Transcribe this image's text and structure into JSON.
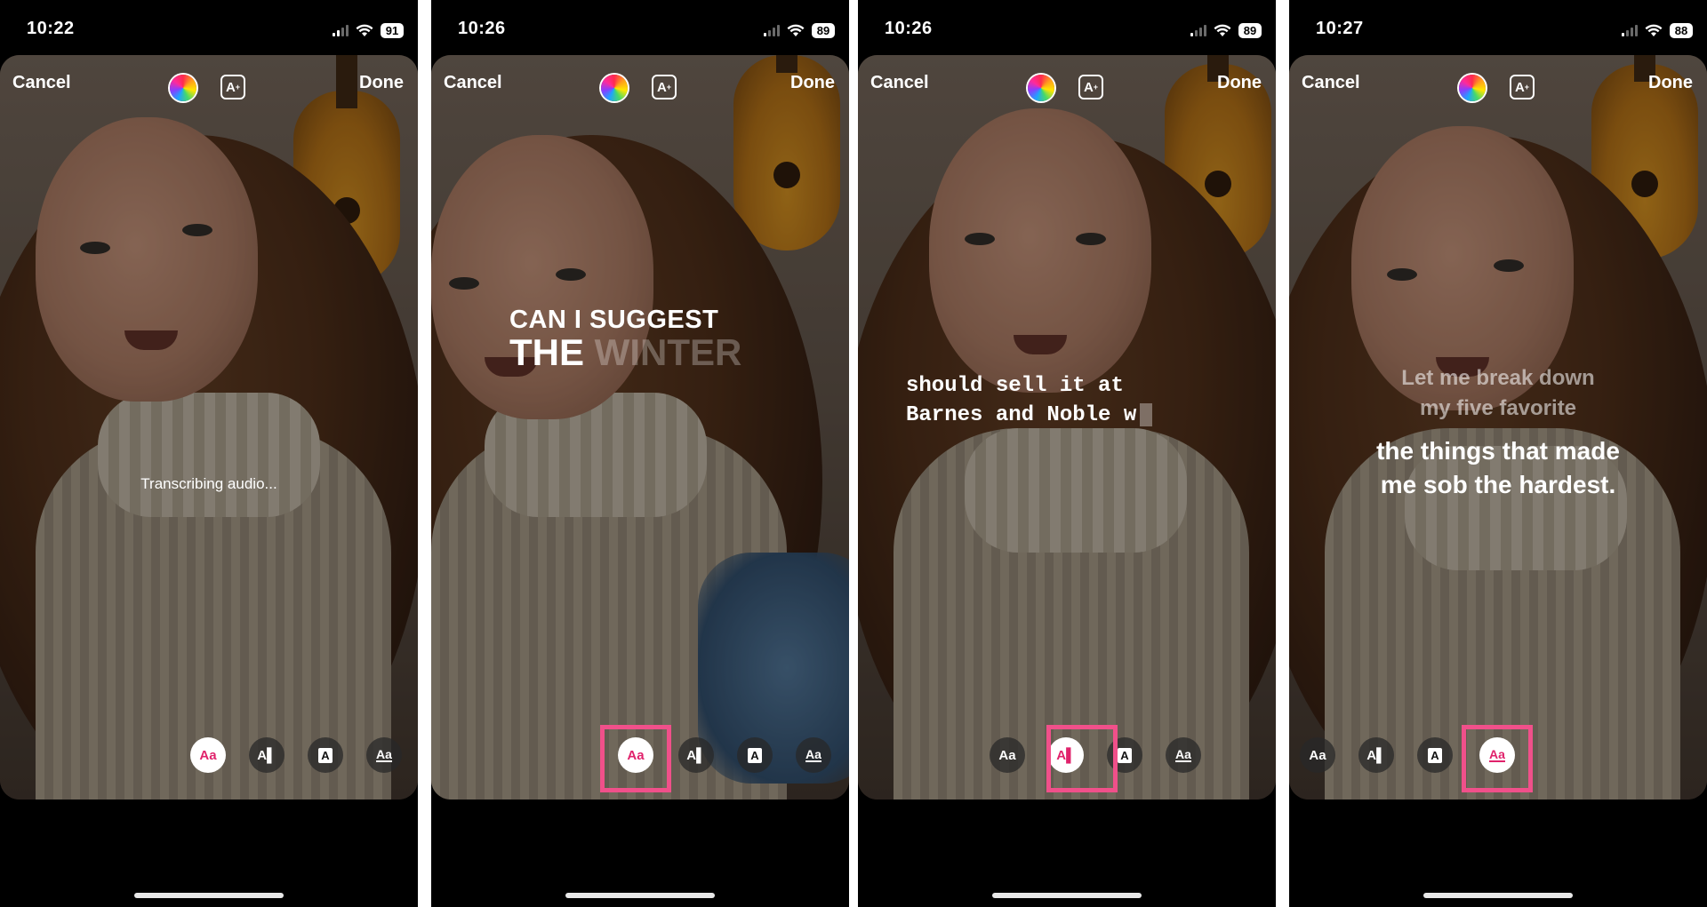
{
  "panels": [
    {
      "time": "10:22",
      "battery": "91",
      "cancel_label": "Cancel",
      "done_label": "Done",
      "caption": {
        "text": "Transcribing audio..."
      },
      "style_buttons": [
        "Aa",
        "A",
        "A",
        "Aa"
      ],
      "active_style": 0
    },
    {
      "time": "10:26",
      "battery": "89",
      "cancel_label": "Cancel",
      "done_label": "Done",
      "caption": {
        "line1": "CAN I SUGGEST",
        "line2_bright": "THE",
        "line2_dim": "WINTER"
      },
      "style_buttons": [
        "Aa",
        "A",
        "A",
        "Aa"
      ],
      "active_style": 0
    },
    {
      "time": "10:26",
      "battery": "89",
      "cancel_label": "Cancel",
      "done_label": "Done",
      "caption": {
        "line1": "should sell it at",
        "line2": "Barnes and Noble w"
      },
      "style_buttons": [
        "Aa",
        "A",
        "A",
        "Aa"
      ],
      "active_style": 1
    },
    {
      "time": "10:27",
      "battery": "88",
      "cancel_label": "Cancel",
      "done_label": "Done",
      "caption": {
        "dim_line1": "Let me break down",
        "dim_line2": "my five favorite",
        "bright_line1": "the things that made",
        "bright_line2": "me sob the hardest."
      },
      "style_buttons": [
        "Aa",
        "A",
        "A",
        "Aa"
      ],
      "active_style": 3
    }
  ],
  "colors": {
    "highlight": "#f0508a",
    "active_glyph": "#e0226b"
  },
  "icons": {
    "color_picker": "color-wheel-icon",
    "text_effect": "sparkle-text-icon"
  }
}
